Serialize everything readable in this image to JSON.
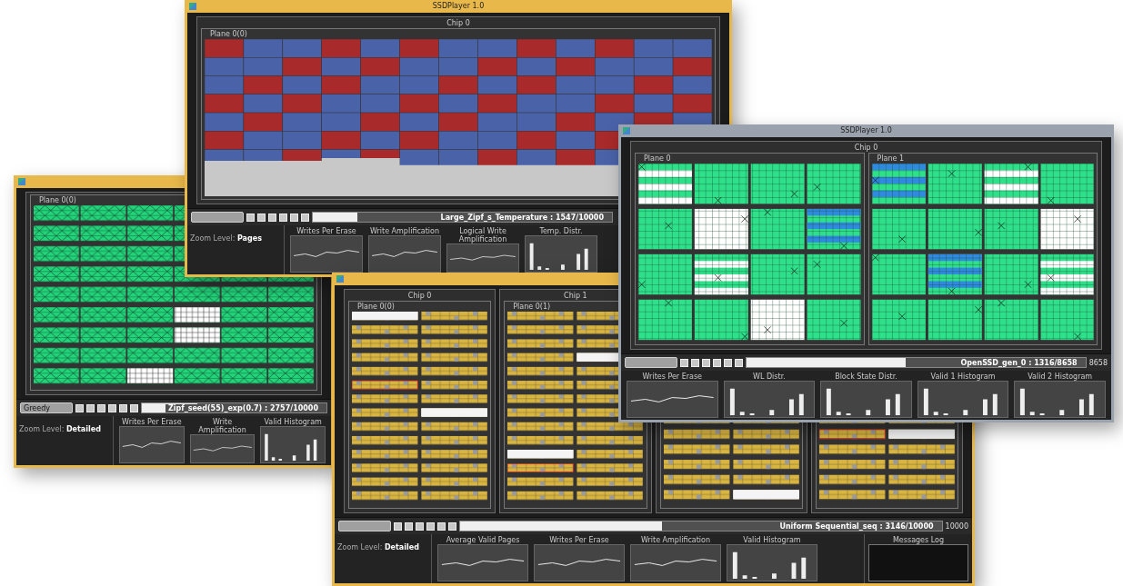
{
  "windows": [
    {
      "color": "#e8b84a",
      "chips": [
        {
          "planes": [
            {
              "label": "Plane 0(0)",
              "kind": "erase"
            }
          ]
        }
      ],
      "toolbar": {
        "algorithm": "Greedy",
        "progress": {
          "label": "Zipf_seed(55)_exp(0.7) : 2757/10000",
          "level": 0.3
        }
      },
      "zoom": "Zoom Level: **Detailed**",
      "charts": [
        {
          "title": "Writes Per Erase",
          "kind": "line"
        },
        {
          "title": "Write Amplification",
          "kind": "line"
        },
        {
          "title": "Valid Histogram",
          "kind": "bar"
        }
      ]
    },
    {
      "color": "#e8b84a",
      "title": "SSDPlayer 1.0",
      "chips": [
        {
          "label": "Chip 0",
          "planes": [
            {
              "label": "Plane 0(0)",
              "kind": "heat"
            }
          ]
        }
      ],
      "toolbar": {
        "progress": {
          "label": "Large_Zipf_s_Temperature : 1547/10000",
          "level": 0.15
        }
      },
      "zoom": "Zoom Level: **Pages**",
      "charts": [
        {
          "title": "Writes Per Erase",
          "kind": "line"
        },
        {
          "title": "Write Amplification",
          "kind": "line"
        },
        {
          "title": "Logical Write Amplification",
          "kind": "line"
        },
        {
          "title": "Temp. Distr.",
          "kind": "bar"
        }
      ]
    },
    {
      "color": "#e8b84a",
      "chips": [
        {
          "label": "Chip 0",
          "planes": [
            {
              "label": "Plane 0(0)",
              "kind": "detailed"
            }
          ]
        },
        {
          "label": "Chip 1",
          "planes": [
            {
              "label": "Plane 0(1)",
              "kind": "detailed"
            }
          ]
        },
        {
          "planes": [
            {
              "kind": "detailed"
            }
          ]
        },
        {
          "planes": [
            {
              "kind": "detailed"
            }
          ]
        }
      ],
      "toolbar": {
        "progress": {
          "label": "Uniform Sequential_seq : 3146/10000",
          "level": 0.42
        },
        "total": "10000"
      },
      "zoom": "Zoom Level: **Detailed**",
      "charts": [
        {
          "title": "Average Valid Pages",
          "kind": "line"
        },
        {
          "title": "Writes Per Erase",
          "kind": "line"
        },
        {
          "title": "Write Amplification",
          "kind": "line"
        },
        {
          "title": "Valid Histogram",
          "kind": "bar"
        }
      ],
      "side_panel": {
        "title": "Messages Log"
      }
    },
    {
      "color": "#9aa3ad",
      "title": "SSDPlayer 1.0",
      "chips": [
        {
          "label": "Chip 0",
          "planes": [
            {
              "label": "Plane 0",
              "kind": "clean"
            },
            {
              "label": "Plane 1",
              "kind": "clean"
            }
          ]
        }
      ],
      "toolbar": {
        "progress": {
          "label": "OpenSSD_gen_0 : 1316/8658",
          "level": 0.47
        },
        "total": "8658"
      },
      "charts": [
        {
          "title": "Writes Per Erase",
          "kind": "line"
        },
        {
          "title": "WL Distr.",
          "kind": "bar"
        },
        {
          "title": "Block State Distr.",
          "kind": "bar"
        },
        {
          "title": "Valid 1 Histogram",
          "kind": "bar"
        },
        {
          "title": "Valid 2 Histogram",
          "kind": "bar"
        }
      ]
    }
  ]
}
